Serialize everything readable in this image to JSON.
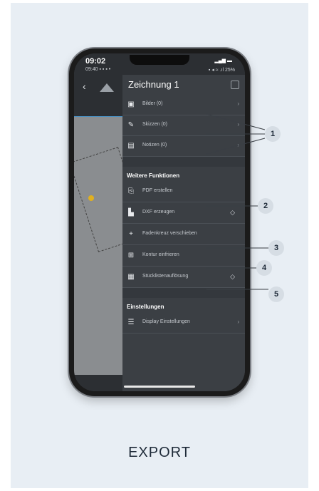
{
  "status": {
    "time": "09:02",
    "time_small": "09:40",
    "battery": "25%"
  },
  "header": {
    "title": "Zeichnung 1"
  },
  "menu": {
    "items": [
      {
        "label": "Bilder (0)",
        "icon": "image-icon"
      },
      {
        "label": "Skizzen (0)",
        "icon": "sketch-icon"
      },
      {
        "label": "Notizen (0)",
        "icon": "note-icon"
      }
    ],
    "weitere_title": "Weitere Funktionen",
    "functions": [
      {
        "label": "PDF erstellen",
        "icon": "pdf-icon"
      },
      {
        "label": "DXF erzeugen",
        "icon": "dxf-icon",
        "premium": true
      },
      {
        "label": "Fadenkreuz verschieben",
        "icon": "crosshair-icon"
      },
      {
        "label": "Kontur einfrieren",
        "icon": "freeze-icon"
      },
      {
        "label": "Stücklistenauflösung",
        "icon": "grid-icon",
        "premium": true
      }
    ],
    "einstellungen_title": "Einstellungen",
    "settings": [
      {
        "label": "Display Einstellungen",
        "icon": "sliders-icon"
      }
    ]
  },
  "callouts": [
    "1",
    "2",
    "3",
    "4",
    "5"
  ],
  "caption": "EXPORT",
  "colors": {
    "card_bg": "#e8eef4",
    "menu_bg": "#3b3f44",
    "callout_bg": "#d6dde4"
  }
}
